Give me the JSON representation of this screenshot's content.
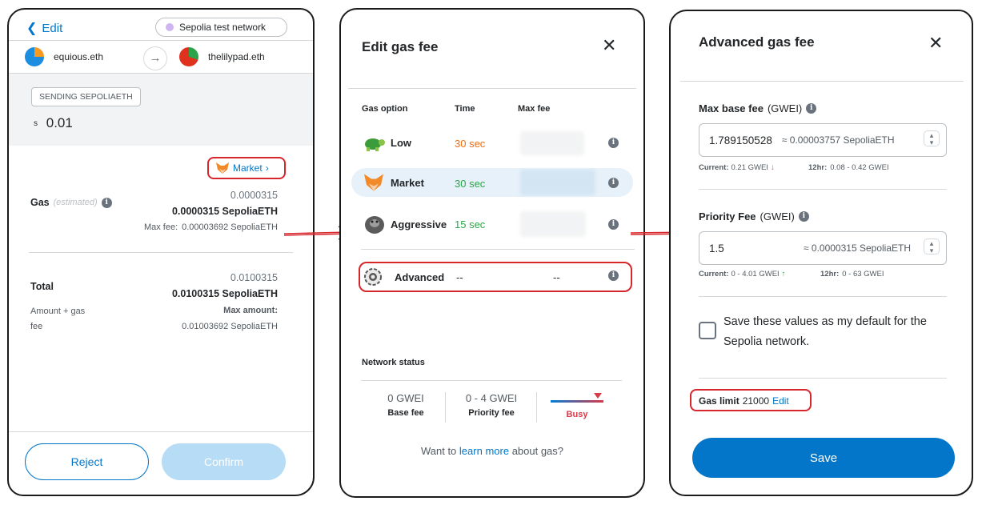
{
  "panel1": {
    "back_label": "Edit",
    "network": "Sepolia test network",
    "from": "equious.eth",
    "to": "thelilypad.eth",
    "sending_badge": "SENDING SEPOLIAETH",
    "amount_prefix": "s",
    "amount": "0.01",
    "market_button": "Market",
    "gas_label": "Gas",
    "gas_estimated": "(estimated)",
    "gas_value": "0.0000315",
    "gas_value_bold": "0.0000315 SepoliaETH",
    "max_fee_label": "Max fee:",
    "max_fee_value": "0.00003692 SepoliaETH",
    "total_label": "Total",
    "total_value": "0.0100315",
    "total_value_bold": "0.0100315 SepoliaETH",
    "amount_gas_label_1": "Amount + gas",
    "amount_gas_label_2": "fee",
    "max_amount_label": "Max amount:",
    "max_amount_value": "0.01003692 SepoliaETH",
    "reject_button": "Reject",
    "confirm_button": "Confirm",
    "colors": {
      "accent": "#0376c9",
      "confirm_bg": "#b7dcf6"
    }
  },
  "panel2": {
    "title": "Edit gas fee",
    "col_option": "Gas option",
    "col_time": "Time",
    "col_max_fee": "Max fee",
    "options": [
      {
        "label": "Low",
        "time": "30 sec",
        "time_color": "#f66a0a",
        "icon": "turtle-icon"
      },
      {
        "label": "Market",
        "time": "30 sec",
        "time_color": "#28a745",
        "icon": "fox-icon"
      },
      {
        "label": "Aggressive",
        "time": "15 sec",
        "time_color": "#28a745",
        "icon": "gorilla-icon"
      },
      {
        "label": "Advanced",
        "time": "--",
        "fee": "--",
        "icon": "gear-icon"
      }
    ],
    "network_status_label": "Network status",
    "base_fee_value": "0 GWEI",
    "base_fee_label": "Base fee",
    "priority_fee_value": "0 - 4 GWEI",
    "priority_fee_label": "Priority fee",
    "busy_label": "Busy",
    "learn_prefix": "Want to",
    "learn_link": "learn more",
    "learn_suffix": "about gas?"
  },
  "panel3": {
    "title": "Advanced gas fee",
    "max_base_fee_label": "Max base fee",
    "max_base_fee_unit": "(GWEI)",
    "max_base_fee_value": "1.789150528",
    "max_base_fee_conv": "≈ 0.00003757 SepoliaETH",
    "current_label_1": "Current:",
    "current_value_1": "0.21 GWEI",
    "hr12_label_1": "12hr:",
    "hr12_value_1": "0.08 - 0.42 GWEI",
    "priority_fee_label": "Priority Fee",
    "priority_fee_unit": "(GWEI)",
    "priority_fee_value": "1.5",
    "priority_fee_conv": "≈ 0.0000315 SepoliaETH",
    "current_label_2": "Current:",
    "current_value_2": "0 - 4.01 GWEI",
    "hr12_label_2": "12hr:",
    "hr12_value_2": "0 - 63 GWEI",
    "save_default_text": "Save these values as my default for the Sepolia network.",
    "gas_limit_label": "Gas limit",
    "gas_limit_value": "21000",
    "gas_limit_edit": "Edit",
    "save_button": "Save",
    "colors": {
      "save_bg": "#0376c9",
      "down": "#d73a49",
      "up": "#28a745"
    }
  }
}
